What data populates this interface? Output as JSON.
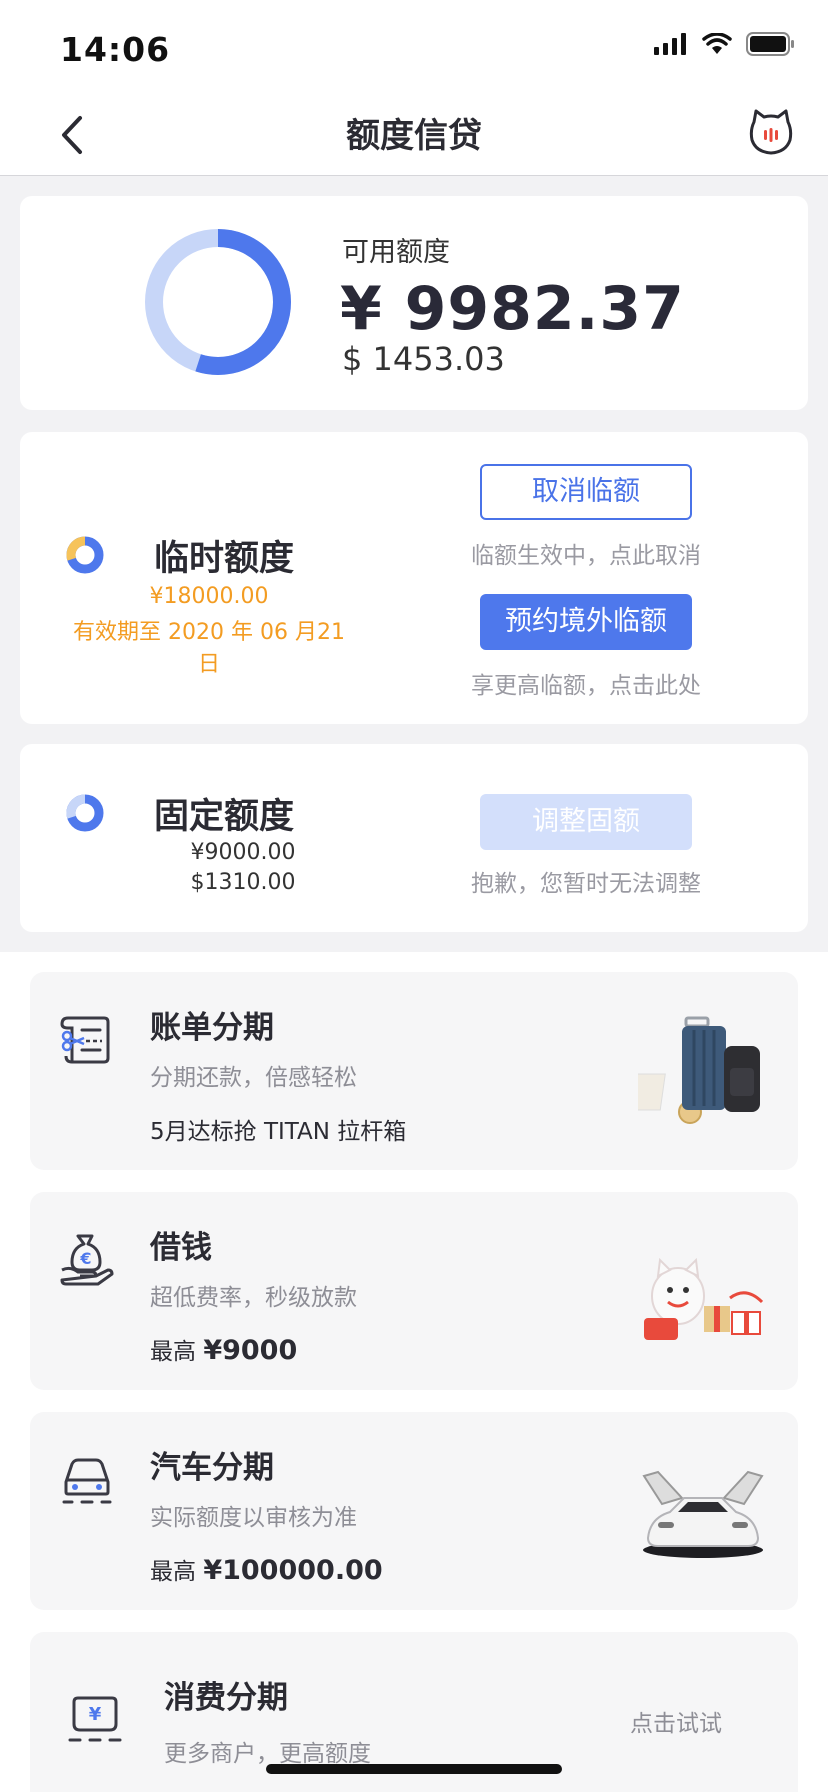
{
  "status_bar": {
    "time": "14:06"
  },
  "nav": {
    "title": "额度信贷",
    "back_icon": "chevron-left-icon",
    "mascot_icon": "cat-mascot-icon"
  },
  "available": {
    "label": "可用额度",
    "yuan": "¥ 9982.37",
    "usd": "$ 1453.03",
    "ring_fill_fraction": 0.55,
    "ring_color": "#4e78ec",
    "ring_track_color": "#c7d6f8"
  },
  "temporary": {
    "title": "临时额度",
    "amount": "¥18000.00",
    "valid_until": "有效期至 2020 年 06 月21日",
    "cancel_button": "取消临额",
    "cancel_hint": "临额生效中，点此取消",
    "book_button": "预约境外临额",
    "book_hint": "享更高临额，点击此处",
    "amount_color": "#f39c22"
  },
  "fixed": {
    "title": "固定额度",
    "yuan": "¥9000.00",
    "usd": "$1310.00",
    "adjust_button": "调整固额",
    "adjust_hint": "抱歉，您暂时无法调整"
  },
  "products": [
    {
      "title": "账单分期",
      "subtitle": "分期还款，倍感轻松",
      "footer": "5月达标抢 TITAN 拉杆箱",
      "icon": "bill-installment-icon",
      "image": "luggage-image"
    },
    {
      "title": "借钱",
      "subtitle": "超低费率，秒级放款",
      "footer_prefix": "最高",
      "footer_value": "¥9000",
      "icon": "money-bag-hand-icon",
      "image": "mascot-gift-image"
    },
    {
      "title": "汽车分期",
      "subtitle": "实际额度以审核为准",
      "footer_prefix": "最高",
      "footer_value": "¥100000.00",
      "icon": "car-icon",
      "image": "car-image"
    },
    {
      "title": "消费分期",
      "subtitle": "更多商户，更高额度",
      "action": "点击试试",
      "icon": "shopping-bag-yuan-icon"
    }
  ]
}
